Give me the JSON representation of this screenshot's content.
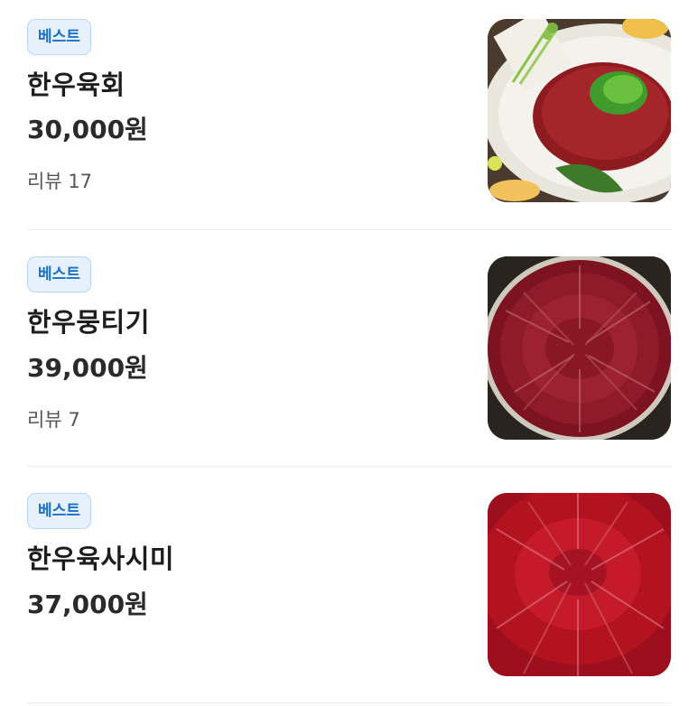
{
  "menu": {
    "items": [
      {
        "badge": "베스트",
        "name": "한우육회",
        "price": "30,000원",
        "review": "리뷰 17",
        "image": "yukhoe-photo"
      },
      {
        "badge": "베스트",
        "name": "한우뭉티기",
        "price": "39,000원",
        "review": "리뷰 7",
        "image": "mungtigi-photo"
      },
      {
        "badge": "베스트",
        "name": "한우육사시미",
        "price": "37,000원",
        "image": "yuk-sashimi-photo"
      }
    ]
  },
  "colors": {
    "badge_text": "#1b6fc7",
    "badge_bg": "#e6f1fd",
    "badge_border": "#b9d7f5",
    "divider": "#ececec"
  }
}
